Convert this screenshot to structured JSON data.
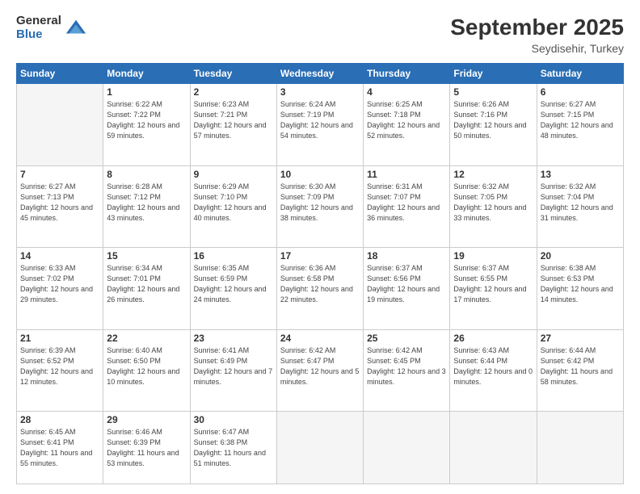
{
  "header": {
    "logo_general": "General",
    "logo_blue": "Blue",
    "month": "September 2025",
    "location": "Seydisehir, Turkey"
  },
  "days_of_week": [
    "Sunday",
    "Monday",
    "Tuesday",
    "Wednesday",
    "Thursday",
    "Friday",
    "Saturday"
  ],
  "weeks": [
    [
      {
        "day": "",
        "info": ""
      },
      {
        "day": "1",
        "info": "Sunrise: 6:22 AM\nSunset: 7:22 PM\nDaylight: 12 hours\nand 59 minutes."
      },
      {
        "day": "2",
        "info": "Sunrise: 6:23 AM\nSunset: 7:21 PM\nDaylight: 12 hours\nand 57 minutes."
      },
      {
        "day": "3",
        "info": "Sunrise: 6:24 AM\nSunset: 7:19 PM\nDaylight: 12 hours\nand 54 minutes."
      },
      {
        "day": "4",
        "info": "Sunrise: 6:25 AM\nSunset: 7:18 PM\nDaylight: 12 hours\nand 52 minutes."
      },
      {
        "day": "5",
        "info": "Sunrise: 6:26 AM\nSunset: 7:16 PM\nDaylight: 12 hours\nand 50 minutes."
      },
      {
        "day": "6",
        "info": "Sunrise: 6:27 AM\nSunset: 7:15 PM\nDaylight: 12 hours\nand 48 minutes."
      }
    ],
    [
      {
        "day": "7",
        "info": "Sunrise: 6:27 AM\nSunset: 7:13 PM\nDaylight: 12 hours\nand 45 minutes."
      },
      {
        "day": "8",
        "info": "Sunrise: 6:28 AM\nSunset: 7:12 PM\nDaylight: 12 hours\nand 43 minutes."
      },
      {
        "day": "9",
        "info": "Sunrise: 6:29 AM\nSunset: 7:10 PM\nDaylight: 12 hours\nand 40 minutes."
      },
      {
        "day": "10",
        "info": "Sunrise: 6:30 AM\nSunset: 7:09 PM\nDaylight: 12 hours\nand 38 minutes."
      },
      {
        "day": "11",
        "info": "Sunrise: 6:31 AM\nSunset: 7:07 PM\nDaylight: 12 hours\nand 36 minutes."
      },
      {
        "day": "12",
        "info": "Sunrise: 6:32 AM\nSunset: 7:05 PM\nDaylight: 12 hours\nand 33 minutes."
      },
      {
        "day": "13",
        "info": "Sunrise: 6:32 AM\nSunset: 7:04 PM\nDaylight: 12 hours\nand 31 minutes."
      }
    ],
    [
      {
        "day": "14",
        "info": "Sunrise: 6:33 AM\nSunset: 7:02 PM\nDaylight: 12 hours\nand 29 minutes."
      },
      {
        "day": "15",
        "info": "Sunrise: 6:34 AM\nSunset: 7:01 PM\nDaylight: 12 hours\nand 26 minutes."
      },
      {
        "day": "16",
        "info": "Sunrise: 6:35 AM\nSunset: 6:59 PM\nDaylight: 12 hours\nand 24 minutes."
      },
      {
        "day": "17",
        "info": "Sunrise: 6:36 AM\nSunset: 6:58 PM\nDaylight: 12 hours\nand 22 minutes."
      },
      {
        "day": "18",
        "info": "Sunrise: 6:37 AM\nSunset: 6:56 PM\nDaylight: 12 hours\nand 19 minutes."
      },
      {
        "day": "19",
        "info": "Sunrise: 6:37 AM\nSunset: 6:55 PM\nDaylight: 12 hours\nand 17 minutes."
      },
      {
        "day": "20",
        "info": "Sunrise: 6:38 AM\nSunset: 6:53 PM\nDaylight: 12 hours\nand 14 minutes."
      }
    ],
    [
      {
        "day": "21",
        "info": "Sunrise: 6:39 AM\nSunset: 6:52 PM\nDaylight: 12 hours\nand 12 minutes."
      },
      {
        "day": "22",
        "info": "Sunrise: 6:40 AM\nSunset: 6:50 PM\nDaylight: 12 hours\nand 10 minutes."
      },
      {
        "day": "23",
        "info": "Sunrise: 6:41 AM\nSunset: 6:49 PM\nDaylight: 12 hours\nand 7 minutes."
      },
      {
        "day": "24",
        "info": "Sunrise: 6:42 AM\nSunset: 6:47 PM\nDaylight: 12 hours\nand 5 minutes."
      },
      {
        "day": "25",
        "info": "Sunrise: 6:42 AM\nSunset: 6:45 PM\nDaylight: 12 hours\nand 3 minutes."
      },
      {
        "day": "26",
        "info": "Sunrise: 6:43 AM\nSunset: 6:44 PM\nDaylight: 12 hours\nand 0 minutes."
      },
      {
        "day": "27",
        "info": "Sunrise: 6:44 AM\nSunset: 6:42 PM\nDaylight: 11 hours\nand 58 minutes."
      }
    ],
    [
      {
        "day": "28",
        "info": "Sunrise: 6:45 AM\nSunset: 6:41 PM\nDaylight: 11 hours\nand 55 minutes."
      },
      {
        "day": "29",
        "info": "Sunrise: 6:46 AM\nSunset: 6:39 PM\nDaylight: 11 hours\nand 53 minutes."
      },
      {
        "day": "30",
        "info": "Sunrise: 6:47 AM\nSunset: 6:38 PM\nDaylight: 11 hours\nand 51 minutes."
      },
      {
        "day": "",
        "info": ""
      },
      {
        "day": "",
        "info": ""
      },
      {
        "day": "",
        "info": ""
      },
      {
        "day": "",
        "info": ""
      }
    ]
  ]
}
